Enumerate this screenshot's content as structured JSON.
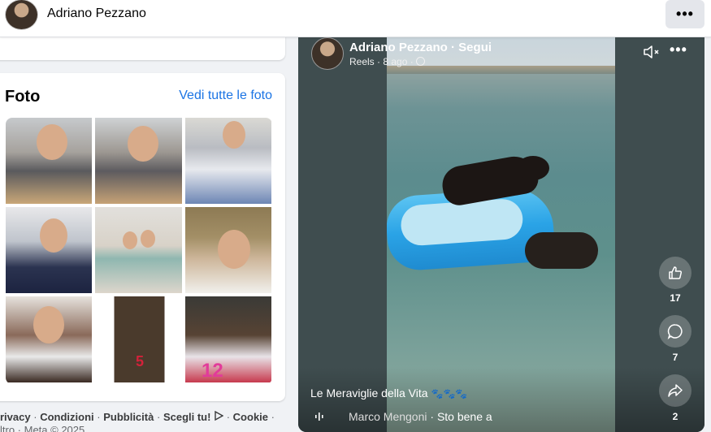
{
  "header": {
    "profile_name": "Adriano Pezzano",
    "more_label": "•••"
  },
  "photos": {
    "title": "Foto",
    "see_all": "Vedi tutte le foto",
    "cake_numbers": [
      "5",
      "12"
    ]
  },
  "footer": {
    "links": [
      "rivacy",
      "Condizioni",
      "Pubblicità",
      "Scegli tu!",
      "Cookie"
    ],
    "separator": "·",
    "copyright": "ltro · Meta © 2025"
  },
  "reel": {
    "author": "Adriano Pezzano · Segui",
    "meta": "Reels · 8 ago ·",
    "more_label": "•••",
    "likes": "17",
    "comments": "7",
    "shares": "2",
    "caption": "Le Meraviglie della Vita",
    "caption_emoji": "🐾🐾🐾",
    "music_artist": "Marco Mengoni",
    "music_title": "Sto bene a"
  },
  "colors": {
    "link_blue": "#1b74e4",
    "page_bg": "#f0f2f5"
  }
}
